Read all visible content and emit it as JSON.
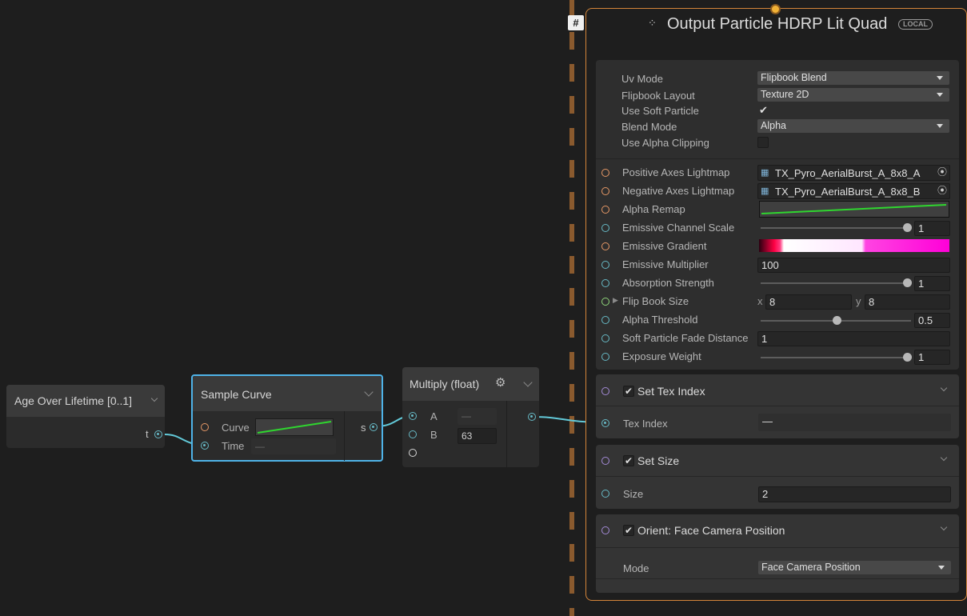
{
  "nodes": {
    "age_over_lifetime": {
      "title": "Age Over Lifetime [0..1]",
      "output_label": "t"
    },
    "sample_curve": {
      "title": "Sample Curve",
      "curve_label": "Curve",
      "time_label": "Time",
      "time_value": "—",
      "output_label": "s"
    },
    "multiply": {
      "title": "Multiply (float)",
      "a_label": "A",
      "a_value": "—",
      "b_label": "B",
      "b_value": "63"
    }
  },
  "context": {
    "title": "Output Particle HDRP Lit Quad",
    "badge": "LOCAL",
    "settings": [
      {
        "label": "Uv Mode",
        "value": "Flipbook Blend"
      },
      {
        "label": "Flipbook Layout",
        "value": "Texture 2D"
      },
      {
        "label": "Use Soft Particle",
        "value": "✔"
      },
      {
        "label": "Blend Mode",
        "value": "Alpha"
      },
      {
        "label": "Use Alpha Clipping",
        "value": ""
      }
    ],
    "properties": {
      "positive_axes": {
        "label": "Positive Axes Lightmap",
        "value": "TX_Pyro_AerialBurst_A_8x8_A"
      },
      "negative_axes": {
        "label": "Negative Axes Lightmap",
        "value": "TX_Pyro_AerialBurst_A_8x8_B"
      },
      "alpha_remap": {
        "label": "Alpha Remap"
      },
      "emissive_channel_scale": {
        "label": "Emissive Channel Scale",
        "value": "1",
        "level": 1.0
      },
      "emissive_gradient": {
        "label": "Emissive Gradient"
      },
      "emissive_multiplier": {
        "label": "Emissive Multiplier",
        "value": "100"
      },
      "absorption_strength": {
        "label": "Absorption Strength",
        "value": "1",
        "level": 1.0
      },
      "flip_book_size": {
        "label": "Flip Book Size",
        "x_label": "x",
        "x": "8",
        "y_label": "y",
        "y": "8"
      },
      "alpha_threshold": {
        "label": "Alpha Threshold",
        "value": "0.5",
        "level": 0.5
      },
      "soft_particle_fade": {
        "label": "Soft Particle Fade Distance",
        "value": "1"
      },
      "exposure_weight": {
        "label": "Exposure Weight",
        "value": "1",
        "level": 1.0
      }
    },
    "blocks": {
      "set_tex_index": {
        "title": "Set Tex Index",
        "field_label": "Tex Index",
        "field_value": "—"
      },
      "set_size": {
        "title": "Set Size",
        "field_label": "Size",
        "field_value": "2"
      },
      "orient": {
        "title": "Orient: Face Camera Position",
        "field_label": "Mode",
        "field_value": "Face Camera Position"
      }
    }
  },
  "colors": {
    "accent_selection": "#4fb3e8",
    "context_border": "#d4853a",
    "wire": "#62c9d8",
    "curve": "#2fd62f"
  }
}
